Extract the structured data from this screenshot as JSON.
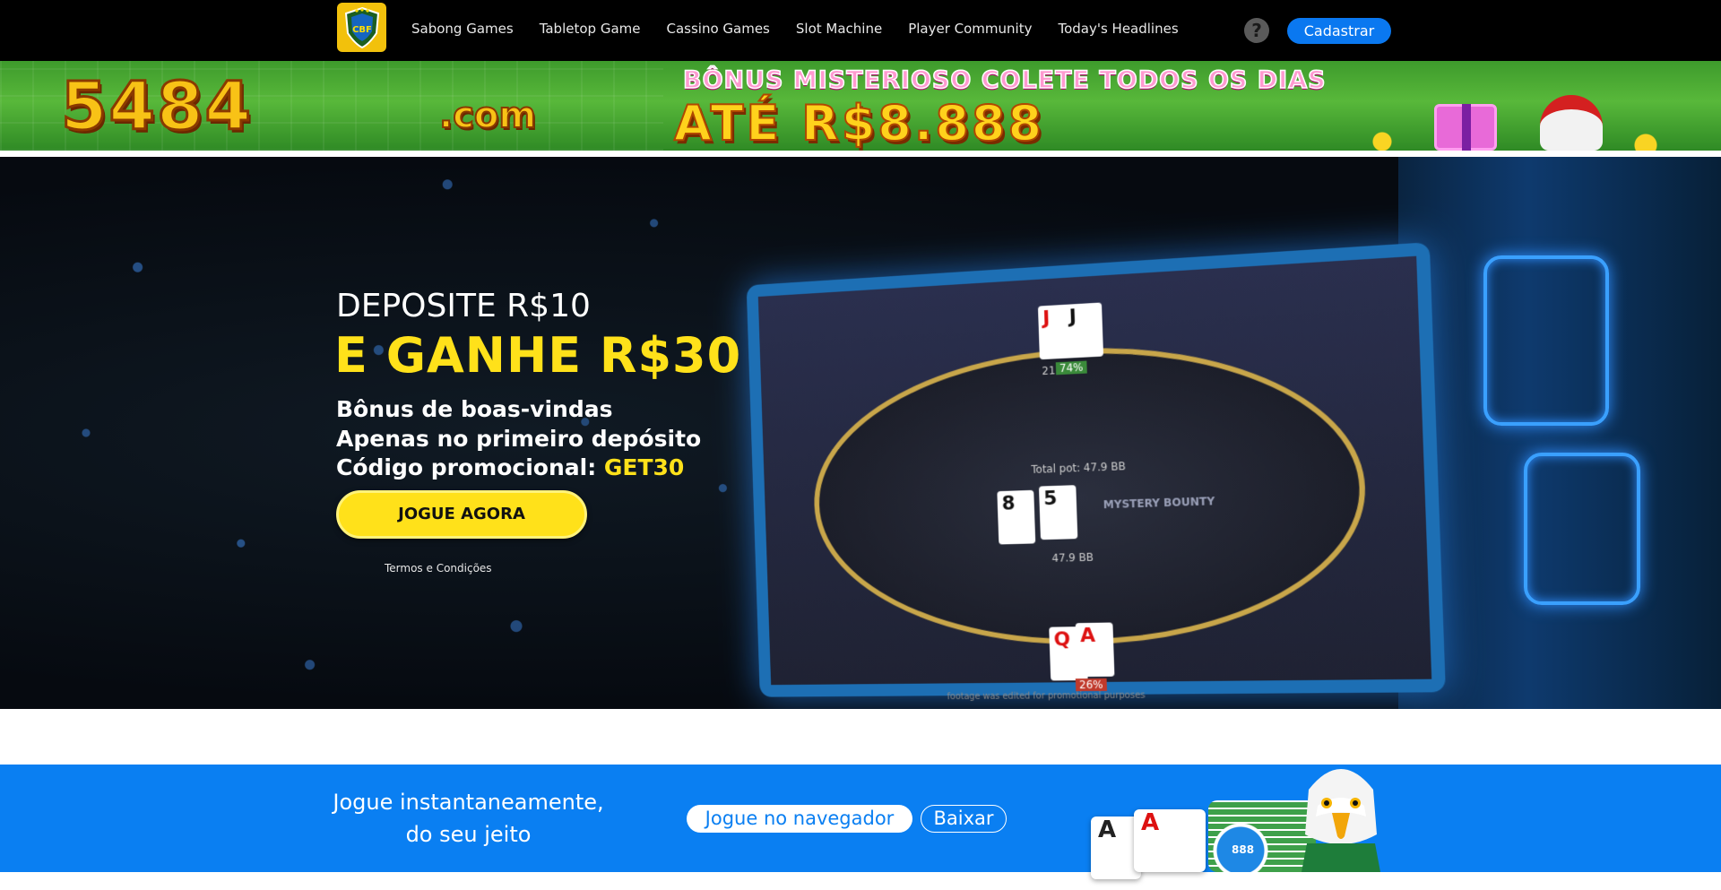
{
  "header": {
    "logo_text": "CBF",
    "nav": [
      {
        "label": "Sabong Games"
      },
      {
        "label": "Tabletop Game"
      },
      {
        "label": "Cassino Games"
      },
      {
        "label": "Slot Machine"
      },
      {
        "label": "Player Community"
      },
      {
        "label": "Today's Headlines"
      }
    ],
    "help_icon": "?",
    "register_label": "Cadastrar"
  },
  "promo_banner": {
    "domain": "5484",
    "domain_suffix": ".com",
    "line1": "BÔNUS MISTERIOSO COLETE TODOS OS DIAS",
    "line2": "ATÉ R$8.888"
  },
  "hero": {
    "line1": "DEPOSITE R$10",
    "line2": "E GANHE R$30",
    "line3": "Bônus de boas-vindas",
    "line4": "Apenas no primeiro depósito",
    "line5_prefix": "Código promocional: ",
    "line5_code": "GET30",
    "cta": "JOGUE AGORA",
    "terms": "Termos e Condições",
    "table": {
      "pot": "Total pot: 47.9 BB",
      "stack_top": "21.6 BB",
      "stack_mid": "47.9 BB",
      "pct_top": "74%",
      "pct_bottom": "26%",
      "mystery": "MYSTERY BOUNTY",
      "footnote": "footage was edited for promotional purposes"
    }
  },
  "cta_strip": {
    "title_line1": "Jogue instantaneamente,",
    "title_line2": "do seu jeito",
    "browser_label": "Jogue no navegador",
    "download_label": "Baixar",
    "chip_label": "888"
  },
  "colors": {
    "accent_yellow": "#ffe11a",
    "brand_blue": "#0a7ff2",
    "nav_bg": "#000000",
    "banner_green": "#4caf33"
  }
}
